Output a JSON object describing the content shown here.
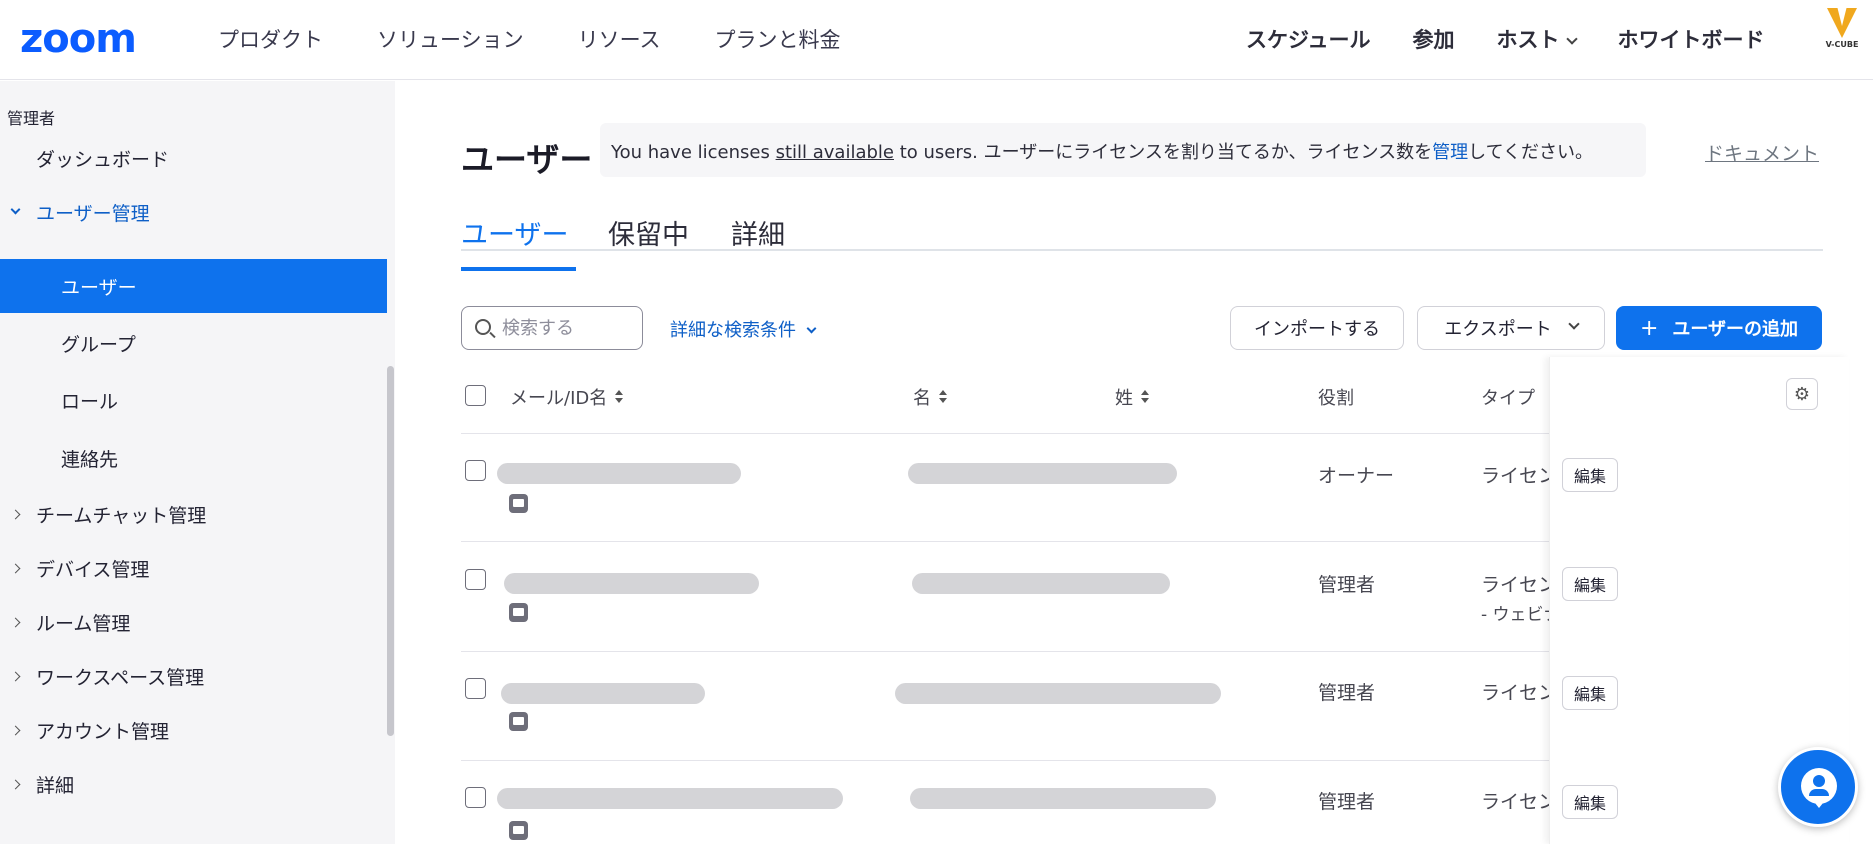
{
  "brand": {
    "logo_text": "zoom",
    "partner_logo_text": "V-CUBE",
    "accent_color": "#0e72ed"
  },
  "topnav": {
    "left": [
      "プロダクト",
      "ソリューション",
      "リソース",
      "プランと料金"
    ],
    "right": [
      "スケジュール",
      "参加",
      "ホスト",
      "ホワイトボード"
    ]
  },
  "sidebar": {
    "section_label": "管理者",
    "items": [
      {
        "label": "ダッシュボード"
      },
      {
        "label": "ユーザー管理",
        "state": "expanded"
      },
      {
        "label": "ユーザー",
        "state": "active"
      },
      {
        "label": "グループ"
      },
      {
        "label": "ロール"
      },
      {
        "label": "連絡先"
      },
      {
        "label": "チームチャット管理"
      },
      {
        "label": "デバイス管理"
      },
      {
        "label": "ルーム管理"
      },
      {
        "label": "ワークスペース管理"
      },
      {
        "label": "アカウント管理"
      },
      {
        "label": "詳細"
      }
    ]
  },
  "main": {
    "title": "ユーザー",
    "banner": {
      "part1": "You have licenses ",
      "underlined": "still available",
      "part2": " to users. ユーザーにライセンスを割り当てるか、ライセンス数を",
      "link": "管理",
      "part3": "してください。"
    },
    "doc_link": "ドキュメント",
    "tabs": [
      "ユーザー",
      "保留中",
      "詳細"
    ],
    "search": {
      "placeholder": "検索する",
      "value": ""
    },
    "advanced_search": "詳細な検索条件",
    "buttons": {
      "import": "インポートする",
      "export": "エクスポート",
      "add_user": "ユーザーの追加",
      "edit": "編集"
    },
    "table": {
      "headers": [
        "メール/ID名",
        "名",
        "姓",
        "役割",
        "タイプ"
      ],
      "rows": [
        {
          "role": "オーナー",
          "type": "ライセンス",
          "type_sub": ""
        },
        {
          "role": "管理者",
          "type": "ライセンス",
          "type_sub": "- ウェビナー"
        },
        {
          "role": "管理者",
          "type": "ライセンス",
          "type_sub": ""
        },
        {
          "role": "管理者",
          "type": "ライセンス",
          "type_sub": ""
        }
      ]
    }
  }
}
